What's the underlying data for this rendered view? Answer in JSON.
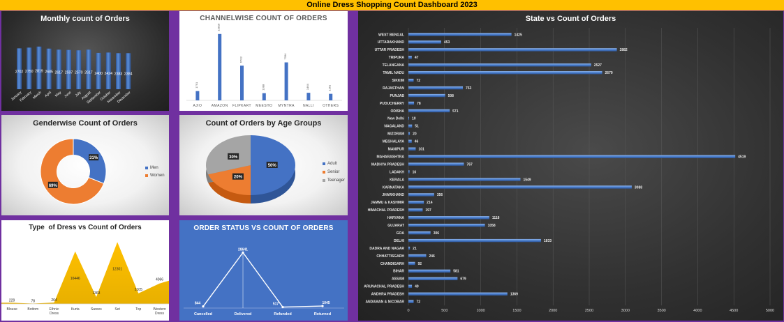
{
  "header": {
    "title": "Online Dress Shopping Count Dashboard 2023"
  },
  "colors": {
    "header_bg": "#ffc000",
    "frame": "#7030a0",
    "bar_blue": "#4472c4",
    "orange": "#ed7d31",
    "gray": "#a5a5a5",
    "yellow": "#ffc000",
    "status_bg": "#4472c4"
  },
  "chart_data": [
    {
      "id": "monthly",
      "type": "bar",
      "title": "Monthly count of Orders",
      "categories": [
        "January",
        "February",
        "March",
        "April",
        "May",
        "June",
        "July",
        "August",
        "September",
        "October",
        "November",
        "December"
      ],
      "values": [
        2702,
        2750,
        2819,
        2685,
        2617,
        2597,
        2570,
        2617,
        2400,
        2424,
        2383,
        2384
      ]
    },
    {
      "id": "channel",
      "type": "bar",
      "title": "CHANNELWISE COUNT OF ORDERS",
      "categories": [
        "AJIO",
        "AMAZON",
        "FLIPKART",
        "MEESHO",
        "MYNTRA",
        "NALLI",
        "OTHERS"
      ],
      "values": [
        1791,
        12818,
        6703,
        1388,
        7334,
        1464,
        1261
      ]
    },
    {
      "id": "gender",
      "type": "pie",
      "title": "Genderwise Count of Orders",
      "labels": [
        "Men",
        "Women"
      ],
      "values": [
        31,
        69
      ],
      "value_labels": [
        "31%",
        "69%"
      ],
      "legend": "right"
    },
    {
      "id": "age",
      "type": "pie",
      "title": "Count of Orders by Age Groups",
      "labels": [
        "Adult",
        "Senior",
        "Teenager"
      ],
      "values": [
        50,
        20,
        30
      ],
      "value_labels": [
        "50%",
        "20%",
        "30%"
      ],
      "legend": "right"
    },
    {
      "id": "dress",
      "type": "area",
      "title": "Type  of Dress vs Count of Orders",
      "categories": [
        "Blouse",
        "Bottom",
        "Ethnic Dress",
        "Kurta",
        "Sarees",
        "Set",
        "Top",
        "Western Dress"
      ],
      "values": [
        229,
        78,
        264,
        10446,
        1363,
        12301,
        2105,
        4066
      ]
    },
    {
      "id": "status",
      "type": "line",
      "title": "ORDER STATUS VS COUNT OF ORDERS",
      "categories": [
        "Cancelled",
        "Delivered",
        "Refunded",
        "Returned"
      ],
      "values": [
        844,
        28641,
        517,
        1045
      ]
    },
    {
      "id": "state",
      "type": "bar",
      "title": "State vs Count of Orders",
      "categories": [
        "WEST BENGAL",
        "UTTARAKHAND",
        "UTTAR PRADESH",
        "TRIPURA",
        "TELANGANA",
        "TAMIL NADU",
        "SIKKIM",
        "RAJASTHAN",
        "PUNJAB",
        "PUDUCHERRY",
        "ODISHA",
        "New Delhi",
        "NAGALAND",
        "MIZORAM",
        "MEGHALAYA",
        "MANIPUR",
        "MAHARASHTRA",
        "MADHYA PRADESH",
        "LADAKH",
        "KERALA",
        "KARNATAKA",
        "JHARKHAND",
        "JAMMU & KASHMIR",
        "HIMACHAL PRADESH",
        "HARYANA",
        "GUJARAT",
        "GOA",
        "DELHI",
        "DADRA AND NAGAR",
        "CHHATTISGARH",
        "CHANDIGARH",
        "BIHAR",
        "ASSAM",
        "ARUNACHAL PRADESH",
        "ANDHRA PRADESH",
        "ANDAMAN & NICOBAR"
      ],
      "values": [
        1425,
        453,
        2882,
        47,
        2527,
        2679,
        72,
        753,
        508,
        78,
        571,
        10,
        51,
        20,
        46,
        101,
        4519,
        767,
        16,
        1549,
        3088,
        356,
        214,
        197,
        1118,
        1058,
        306,
        1833,
        21,
        246,
        92,
        581,
        679,
        49,
        1369,
        72
      ],
      "xlim": [
        0,
        5000
      ],
      "xticks": [
        0,
        500,
        1000,
        1500,
        2000,
        2500,
        3000,
        3500,
        4000,
        4500,
        5000
      ]
    }
  ]
}
